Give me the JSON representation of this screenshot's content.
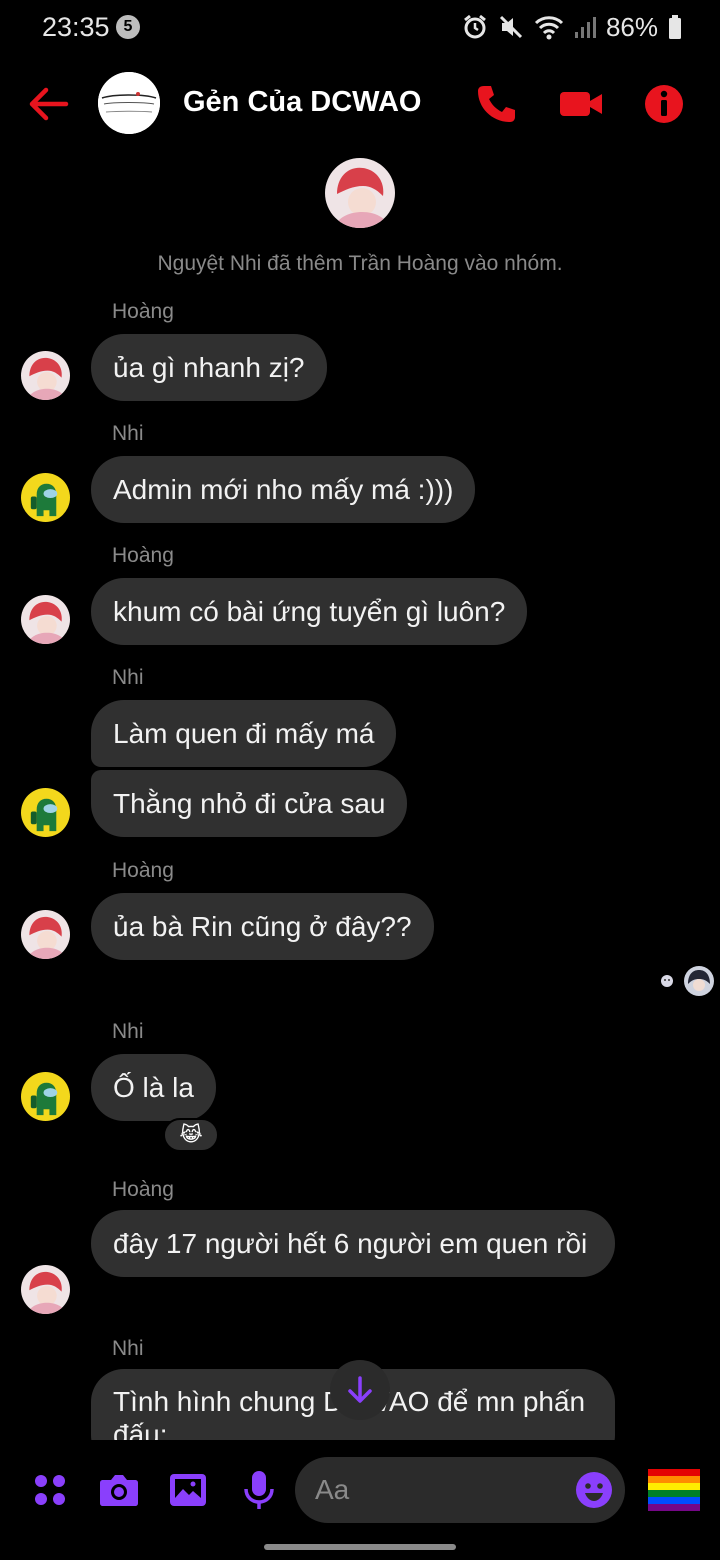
{
  "status_bar": {
    "time": "23:35",
    "notification_count": "5",
    "battery": "86%",
    "icons": [
      "alarm-icon",
      "mute-icon",
      "wifi-icon",
      "signal-icon",
      "battery-icon"
    ]
  },
  "header": {
    "title": "Gẻn Của DCWAO",
    "icons": [
      "back-arrow-icon",
      "phone-icon",
      "video-call-icon",
      "info-icon"
    ],
    "accent_color": "#e8141e"
  },
  "system_message": "Nguyệt Nhi đã thêm Trần Hoàng vào nhóm.",
  "messages": [
    {
      "sender": "Hoàng",
      "text": "ủa gì nhanh zị?"
    },
    {
      "sender": "Nhi",
      "text": "Admin mới nho mấy má :)))"
    },
    {
      "sender": "Hoàng",
      "text": "khum có bài ứng tuyển gì luôn?"
    },
    {
      "sender": "Nhi",
      "text": "Làm quen đi mấy má"
    },
    {
      "sender": "",
      "text": "Thằng nhỏ đi cửa sau"
    },
    {
      "sender": "Hoàng",
      "text": "ủa bà Rin cũng ở đây??"
    },
    {
      "sender": "Nhi",
      "text": "Ố là la",
      "reaction": "😹"
    },
    {
      "sender": "Hoàng",
      "text": "đây 17 người hết 6 người em quen rồi"
    },
    {
      "sender": "Nhi",
      "text": "Tình hình chung DCWAO để mn phấn đấu:"
    }
  ],
  "composer": {
    "placeholder": "Aa",
    "icons": [
      "menu-dots-icon",
      "camera-icon",
      "gallery-icon",
      "microphone-icon",
      "emoji-icon",
      "rainbow-flag-icon"
    ],
    "accent_color": "#8a3ffc"
  }
}
